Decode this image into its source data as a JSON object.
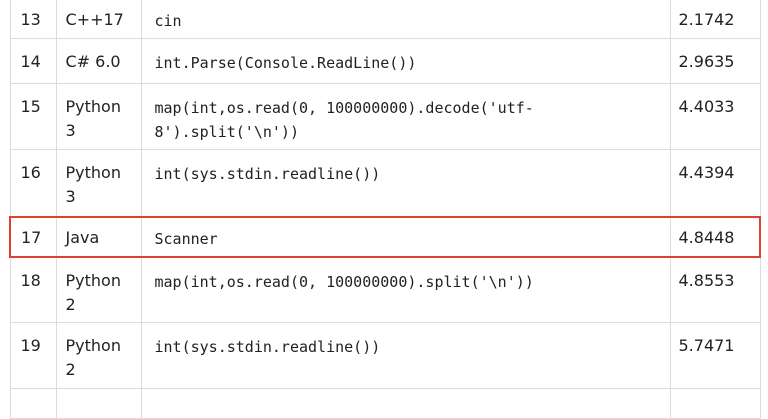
{
  "table": {
    "rows": [
      {
        "rank": "13",
        "language": "C++17",
        "method": "cin",
        "time": "2.1742"
      },
      {
        "rank": "14",
        "language": "C# 6.0",
        "method": "int.Parse(Console.ReadLine())",
        "time": "2.9635"
      },
      {
        "rank": "15",
        "language": "Python 3",
        "method": "map(int,os.read(0, 100000000).decode('utf-8').split('\\n'))",
        "time": "4.4033"
      },
      {
        "rank": "16",
        "language": "Python 3",
        "method": "int(sys.stdin.readline())",
        "time": "4.4394"
      },
      {
        "rank": "17",
        "language": "Java",
        "method": "Scanner",
        "time": "4.8448"
      },
      {
        "rank": "18",
        "language": "Python 2",
        "method": "map(int,os.read(0, 100000000).split('\\n'))",
        "time": "4.8553"
      },
      {
        "rank": "19",
        "language": "Python 2",
        "method": "int(sys.stdin.readline())",
        "time": "5.7471"
      }
    ],
    "highlight_color": "#e0412e",
    "border_color": "#dcdcdc"
  }
}
